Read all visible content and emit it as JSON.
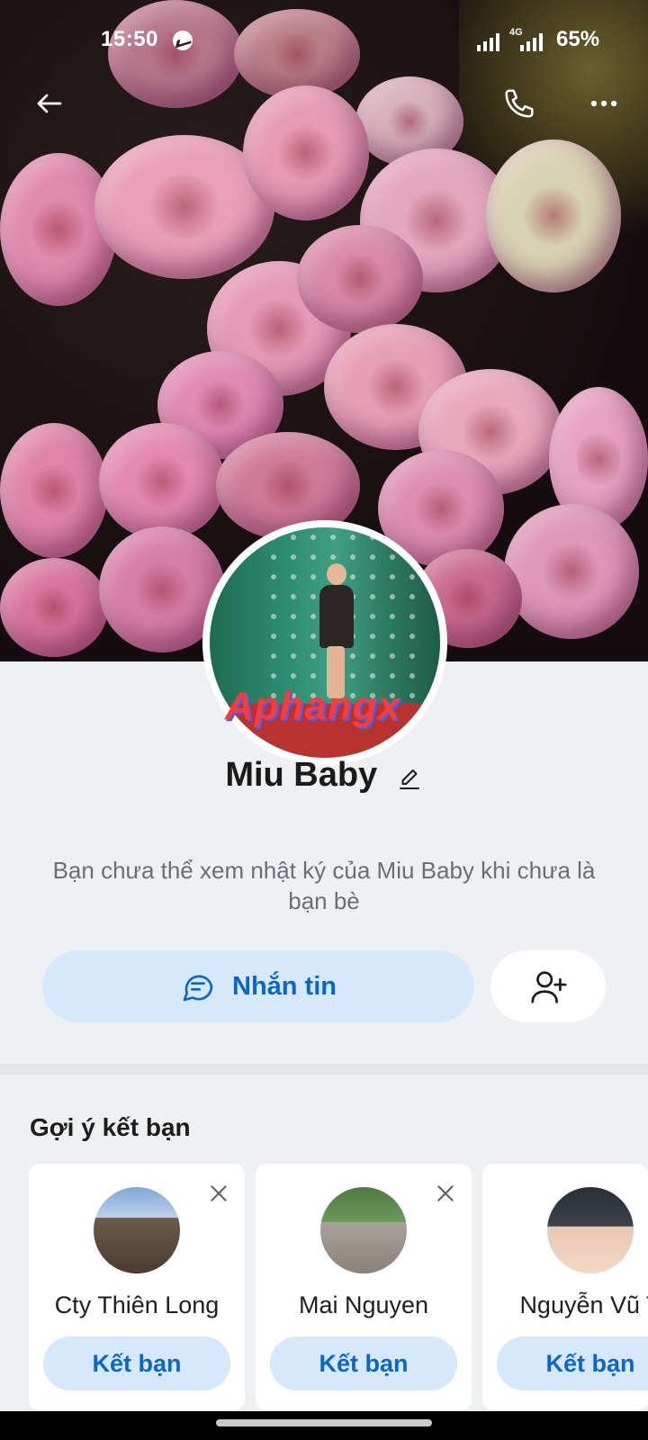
{
  "status_bar": {
    "time": "15:50",
    "network": "4G",
    "battery": "65%"
  },
  "header": {
    "back_icon": "arrow-left-icon",
    "call_icon": "phone-icon",
    "more_icon": "more-horizontal-icon"
  },
  "profile": {
    "name": "Miu Baby",
    "watermark": "Aphangx",
    "notice": "Bạn chưa thể xem nhật ký của Miu Baby khi chưa là bạn bè",
    "message_button": "Nhắn tin"
  },
  "suggestions": {
    "title": "Gợi ý kết bạn",
    "items": [
      {
        "name": "Cty Thiên Long",
        "button": "Kết bạn"
      },
      {
        "name": "Mai Nguyen",
        "button": "Kết bạn"
      },
      {
        "name": "Nguyễn Vũ T",
        "button": "Kết bạn"
      }
    ]
  },
  "colors": {
    "accent": "#0b67c7",
    "accent_soft": "#d6e8fb",
    "background": "#eef0f2"
  }
}
